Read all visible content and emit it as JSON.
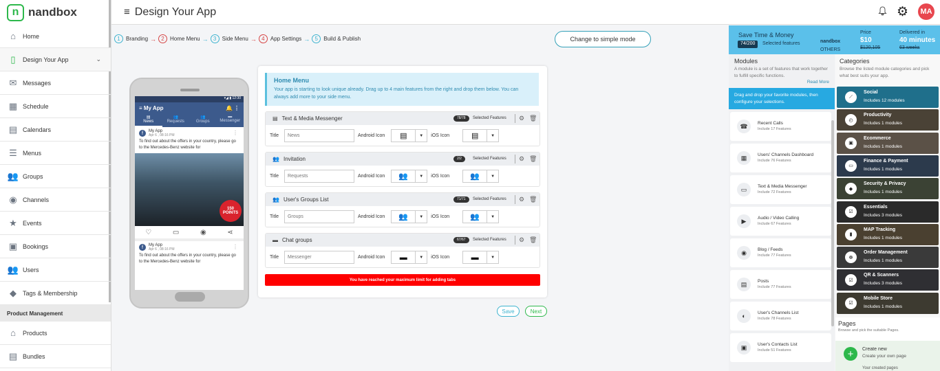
{
  "brand": {
    "logo_letter": "n",
    "name": "nandbox"
  },
  "header": {
    "menu_glyph": "≡",
    "title": "Design Your App",
    "avatar": "MA"
  },
  "sidebar": {
    "items": [
      {
        "label": "Home",
        "icon": "⌂"
      },
      {
        "label": "Design Your App",
        "icon": "▯",
        "chevron": "⌄"
      },
      {
        "label": "Messages",
        "icon": "✉"
      },
      {
        "label": "Schedule",
        "icon": "▦"
      },
      {
        "label": "Calendars",
        "icon": "▤"
      },
      {
        "label": "Menus",
        "icon": "☰"
      },
      {
        "label": "Groups",
        "icon": "👥"
      },
      {
        "label": "Channels",
        "icon": "◉"
      },
      {
        "label": "Events",
        "icon": "★"
      },
      {
        "label": "Bookings",
        "icon": "▣"
      },
      {
        "label": "Users",
        "icon": "👥"
      },
      {
        "label": "Tags & Membership",
        "icon": "◆"
      }
    ],
    "section": "Product Management",
    "section_items": [
      {
        "label": "Products",
        "icon": "⌂"
      },
      {
        "label": "Bundles",
        "icon": "▤"
      }
    ]
  },
  "steps": [
    {
      "num": "1",
      "label": "Branding",
      "color": "#3db3cf"
    },
    {
      "num": "2",
      "label": "Home Menu",
      "color": "#d64545"
    },
    {
      "num": "3",
      "label": "Side Menu",
      "color": "#3db3cf"
    },
    {
      "num": "4",
      "label": "App Settings",
      "color": "#d64545"
    },
    {
      "num": "5",
      "label": "Build & Publish",
      "color": "#3db3cf"
    }
  ],
  "simple_mode_label": "Change to simple mode",
  "phone": {
    "time": "12:30",
    "app_title": "My App",
    "tabs": [
      "News",
      "Requests",
      "Groups",
      "Messenger"
    ],
    "post": {
      "name": "My App",
      "date": "Apr 6 , 08:16 PM",
      "text": "To find out about the offers in your country, please go to the Mercedes-Benz website for"
    },
    "badge_value": "150",
    "badge_label": "POINTS"
  },
  "home_menu": {
    "title": "Home Menu",
    "desc": "Your app is starting to look unique already. Drag up to 4 main features from the right and drop them below. You can always add more to your side menu.",
    "selected_label": "Selected Features",
    "title_label": "Title",
    "android_label": "Android Icon",
    "ios_label": "iOS Icon",
    "features": [
      {
        "name": "Text & Media Messenger",
        "count": "78/78",
        "title_value": "News",
        "icon": "▤"
      },
      {
        "name": "Invitation",
        "count": "2/2",
        "title_value": "Requests",
        "icon": "👥"
      },
      {
        "name": "User's Groups List",
        "count": "71/71",
        "title_value": "Groups",
        "icon": "👥"
      },
      {
        "name": "Chat groups",
        "count": "67/67",
        "title_value": "Messenger",
        "icon": "▬"
      }
    ],
    "limit_message": "You have reached your maximum limit for adding tabs"
  },
  "buttons": {
    "save": "Save",
    "next": "Next"
  },
  "promo": {
    "title": "Save Time & Money",
    "count": "74/200",
    "selected": "Selected features",
    "brand": "nandbox",
    "others": "OTHERS",
    "price_label": "Price",
    "price": "$10",
    "price_old": "$120,105",
    "delivered_label": "Delivered in",
    "delivered": "40 minutes",
    "delivered_old": "63 weeks"
  },
  "modules": {
    "title": "Modules",
    "desc": "A module is a set of features that work together to fulfill specific functions.",
    "read_more": "Read More",
    "drag_hint": "Drag and drop your favorite modules, then configure your selections.",
    "items": [
      {
        "name": "Recent Calls",
        "sub": "Include 17 Features",
        "icon": "☎"
      },
      {
        "name": "Users' Channels Dashboard",
        "sub": "Include 76 Features",
        "icon": "▦"
      },
      {
        "name": "Text & Media Messenger",
        "sub": "Include 72 Features",
        "icon": "▭"
      },
      {
        "name": "Audio / Video Calling",
        "sub": "Include 67 Features",
        "icon": "▶"
      },
      {
        "name": "Blog / Feeds",
        "sub": "Include 77 Features",
        "icon": "◉"
      },
      {
        "name": "Posts",
        "sub": "Include 77 Features",
        "icon": "▤"
      },
      {
        "name": "User's Channels List",
        "sub": "Include 78 Features",
        "icon": "◐"
      },
      {
        "name": "User's Contacts List",
        "sub": "Include 51 Features",
        "icon": "▣"
      }
    ]
  },
  "categories": {
    "title": "Categories",
    "desc": "Browse the listed module categories and pick what best suits your app.",
    "items": [
      {
        "name": "Social",
        "sub": "Includes 12 modules",
        "color": "#1f6f8b"
      },
      {
        "name": "Productivity",
        "sub": "Includes 1 modules",
        "color": "#4a4236"
      },
      {
        "name": "Ecommerce",
        "sub": "Includes 1 modules",
        "color": "#5b5147"
      },
      {
        "name": "Finance & Payment",
        "sub": "Includes 1 modules",
        "color": "#2c3a4c"
      },
      {
        "name": "Security & Privacy",
        "sub": "Includes 1 modules",
        "color": "#3b4234"
      },
      {
        "name": "Essentials",
        "sub": "Includes 3 modules",
        "color": "#2a2a2a"
      },
      {
        "name": "MAP Tracking",
        "sub": "Includes 1 modules",
        "color": "#4a4030"
      },
      {
        "name": "Order Management",
        "sub": "Includes 1 modules",
        "color": "#3a3a3a"
      },
      {
        "name": "QR & Scanners",
        "sub": "Includes 3 modules",
        "color": "#2f2f33"
      },
      {
        "name": "Mobile Store",
        "sub": "Includes 1 modules",
        "color": "#3d3a30"
      }
    ]
  },
  "pages": {
    "title": "Pages",
    "desc": "Browse and pick the suitable Pages.",
    "create_title": "Create new",
    "create_sub": "Create your own page",
    "created_label": "Your created pages"
  }
}
